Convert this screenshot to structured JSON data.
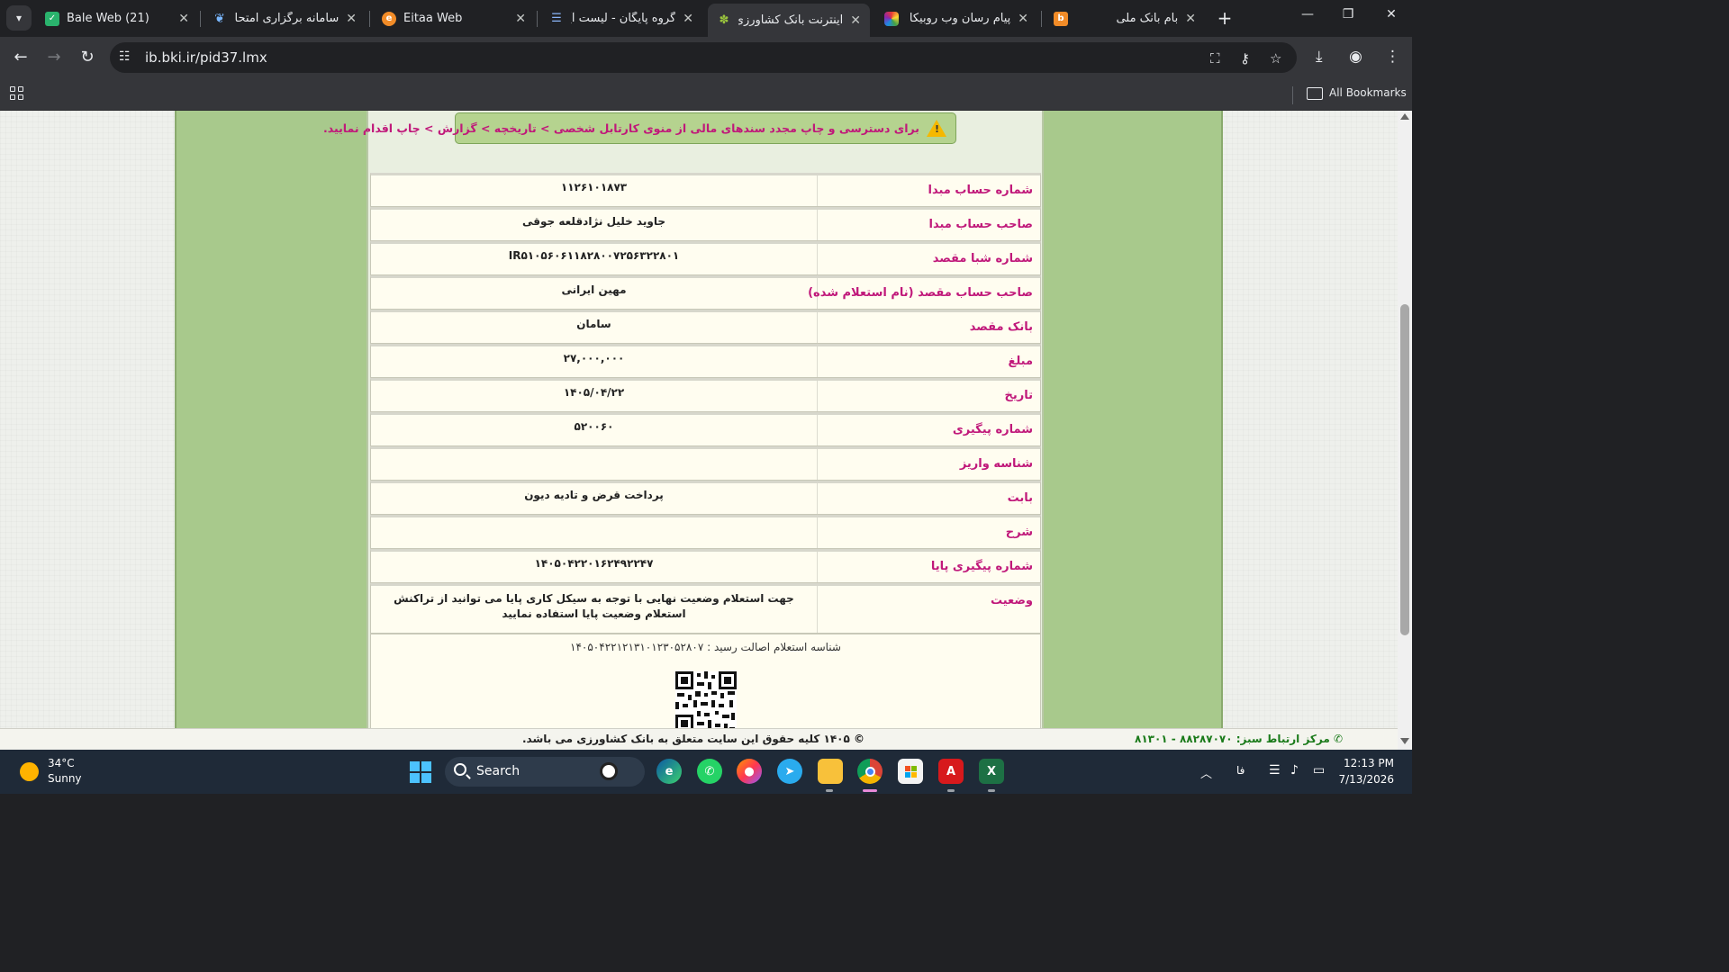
{
  "browser": {
    "tabs": [
      {
        "title": "Bale Web (21)",
        "active": false
      },
      {
        "title": "سامانه برگزاری امتحانات",
        "active": false
      },
      {
        "title": "Eitaa Web",
        "active": false
      },
      {
        "title": "گروه پایگان - لیست آیتم",
        "active": false
      },
      {
        "title": "اینترنت بانک کشاورزی",
        "active": true
      },
      {
        "title": "پیام رسان وب روبیکا",
        "active": false
      },
      {
        "title": "بام بانک ملی",
        "active": false
      }
    ],
    "url": "ib.bki.ir/pid37.lmx",
    "bookmarks_label": "All Bookmarks",
    "colors": {
      "frame": "#202124",
      "toolbar": "#35363a"
    }
  },
  "page": {
    "alert": "برای دسترسی و چاپ مجدد سندهای مالی از منوی کارتابل شخصی > تاریخچه > گزارش > چاپ اقدام نمایید.",
    "rows": [
      {
        "label": "شماره حساب مبدا",
        "value": "۱۱۲۶۱۰۱۸۷۳"
      },
      {
        "label": "صاحب حساب مبدا",
        "value": "جاوید خلیل نژادقلعه جوقی"
      },
      {
        "label": "شماره شبا مقصد",
        "value": "IR۵۱۰۵۶۰۶۱۱۸۲۸۰۰۷۲۵۶۳۲۲۸۰۱"
      },
      {
        "label": "صاحب حساب مقصد (نام استعلام شده)",
        "value": "مهین ایرانی"
      },
      {
        "label": "بانک مقصد",
        "value": "سامان"
      },
      {
        "label": "مبلغ",
        "value": "۲۷,۰۰۰,۰۰۰"
      },
      {
        "label": "تاریخ",
        "value": "۱۴۰۵/۰۴/۲۲"
      },
      {
        "label": "شماره پیگیری",
        "value": "۵۲۰۰۶۰"
      },
      {
        "label": "شناسه واریز",
        "value": ""
      },
      {
        "label": "بابت",
        "value": "پرداخت قرض و تادیه دیون"
      },
      {
        "label": "شرح",
        "value": ""
      },
      {
        "label": "شماره پیگیری پایا",
        "value": "۱۴۰۵۰۴۲۲۰۱۶۲۴۹۲۲۴۷"
      }
    ],
    "status_row": {
      "label": "وضعیت",
      "value": "جهت استعلام وضعیت نهایی با توجه به سیکل کاری پایا می توانید از تراکنش استعلام وضعیت پایا استفاده نمایید"
    },
    "receipt_id": "شناسه استعلام اصالت رسید : ۱۴۰۵۰۴۲۲۱۲۱۳۱۰۱۲۳۰۵۲۸۰۷",
    "footer_copyright": "© ۱۴۰۵ کلیه حقوق این سایت متعلق به بانک کشاورزی می باشد.",
    "footer_support": "مرکز ارتباط سبز: ۸۸۲۸۷۰۷۰ - ۸۱۳۰۱",
    "colors": {
      "label": "#c0187a",
      "frame_green": "#a8c98c",
      "row_bg": "#fffdf0"
    }
  },
  "taskbar": {
    "temperature": "34°C",
    "condition": "Sunny",
    "search_label": "Search",
    "language": "فا",
    "time": "12:13 PM",
    "date": "7/13/2026",
    "apps": [
      "edge-icon",
      "whatsapp-icon",
      "firefox-icon",
      "telegram-icon",
      "file-explorer-icon",
      "chrome-icon",
      "store-icon",
      "acrobat-icon",
      "excel-icon"
    ]
  }
}
